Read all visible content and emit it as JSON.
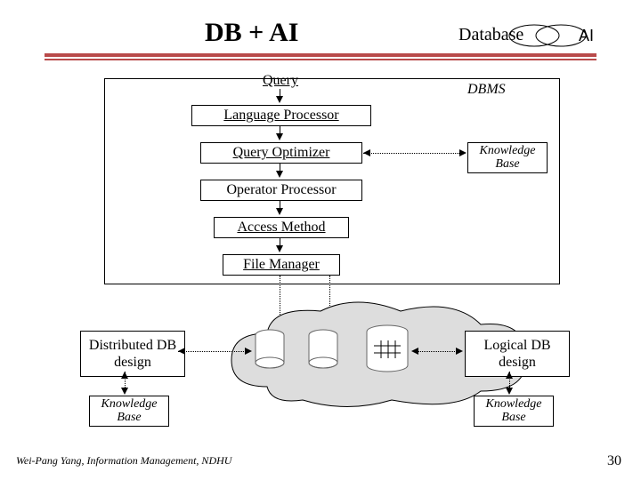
{
  "title": "DB + AI",
  "venn": {
    "left": "Database",
    "right": "AI"
  },
  "dbms_label": "DBMS",
  "stages": {
    "query": "Query",
    "lang": "Language  Processor",
    "opt": "Query Optimizer",
    "oper": "Operator Processor",
    "access": "Access Method",
    "file": "File Manager"
  },
  "knowledge_base": "Knowledge\nBase",
  "distributed": "Distributed\nDB design",
  "logical": "Logical\nDB design",
  "footer": "Wei-Pang Yang, Information Management, NDHU",
  "page": "30"
}
